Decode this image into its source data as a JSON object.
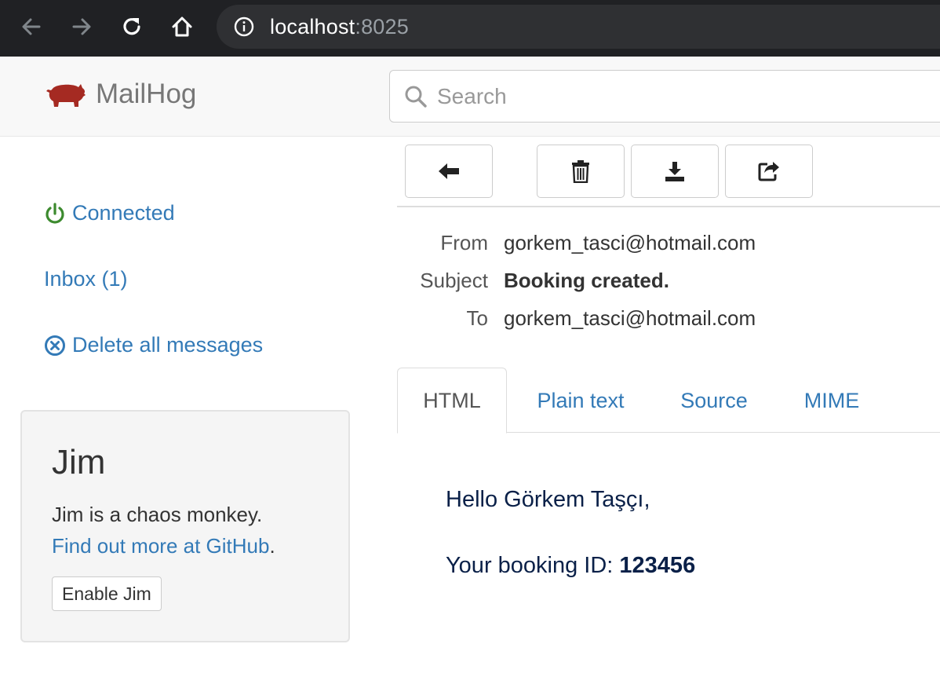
{
  "browser": {
    "url_host": "localhost",
    "url_port": ":8025",
    "icons": [
      "back-arrow-icon",
      "forward-arrow-icon",
      "reload-icon",
      "home-icon",
      "info-icon"
    ]
  },
  "app": {
    "brand_name": "MailHog",
    "search_placeholder": "Search"
  },
  "sidebar": {
    "connected_label": "Connected",
    "inbox_label": "Inbox (1)",
    "delete_all_label": "Delete all messages",
    "jim": {
      "title": "Jim",
      "description": "Jim is a chaos monkey.",
      "link_text": "Find out more at GitHub",
      "link_suffix": ".",
      "button_label": "Enable Jim"
    }
  },
  "toolbar": {
    "icons": [
      "back-arrow-icon",
      "trash-icon",
      "download-icon",
      "release-icon"
    ]
  },
  "message": {
    "headers": [
      {
        "label": "From",
        "value": "gorkem_tasci@hotmail.com"
      },
      {
        "label": "Subject",
        "value": "Booking created."
      },
      {
        "label": "To",
        "value": "gorkem_tasci@hotmail.com"
      }
    ],
    "tabs": [
      "HTML",
      "Plain text",
      "Source",
      "MIME"
    ],
    "active_tab": "HTML",
    "body": {
      "greeting": "Hello Görkem Taşçı,",
      "booking_prefix": "Your booking ID: ",
      "booking_id": "123456"
    }
  },
  "colors": {
    "link": "#337ab7",
    "connected_icon": "#3c8a2e",
    "brand_pig": "#a52a22",
    "body_text": "#0a2048"
  }
}
